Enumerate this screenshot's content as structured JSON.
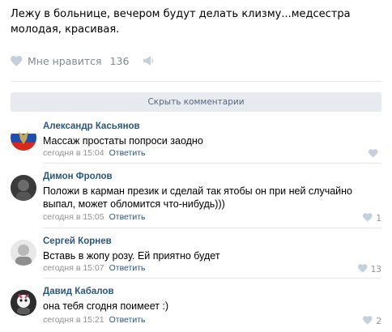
{
  "post": {
    "text": "Лежу в больнице, вечером будут делать клизму...медсестра молодая, красивая.",
    "likes_label": "Мне нравится",
    "likes_count": "136"
  },
  "comments_toggle_label": "Скрыть комментарии",
  "comments": [
    {
      "author": "Александр Касьянов",
      "text": "Массаж простаты попроси заодно",
      "time": "сегодня в 15:04",
      "reply": "Ответить",
      "likes": ""
    },
    {
      "author": "Димон Фролов",
      "text": "Положи в карман презик и сделай так ятобы он при ней случайно выпал, может обломится что-нибудь)))",
      "time": "сегодня в 15:05",
      "reply": "Ответить",
      "likes": "1"
    },
    {
      "author": "Сергей Корнев",
      "text": "Вставь в жопу розу. Ей приятно будет",
      "time": "сегодня в 15:07",
      "reply": "Ответить",
      "likes": "13"
    },
    {
      "author": "Давид Кабалов",
      "text": "она тебя сгодня поимеет :)",
      "time": "сегодня в 15:21",
      "reply": "Ответить",
      "likes": "2"
    }
  ]
}
